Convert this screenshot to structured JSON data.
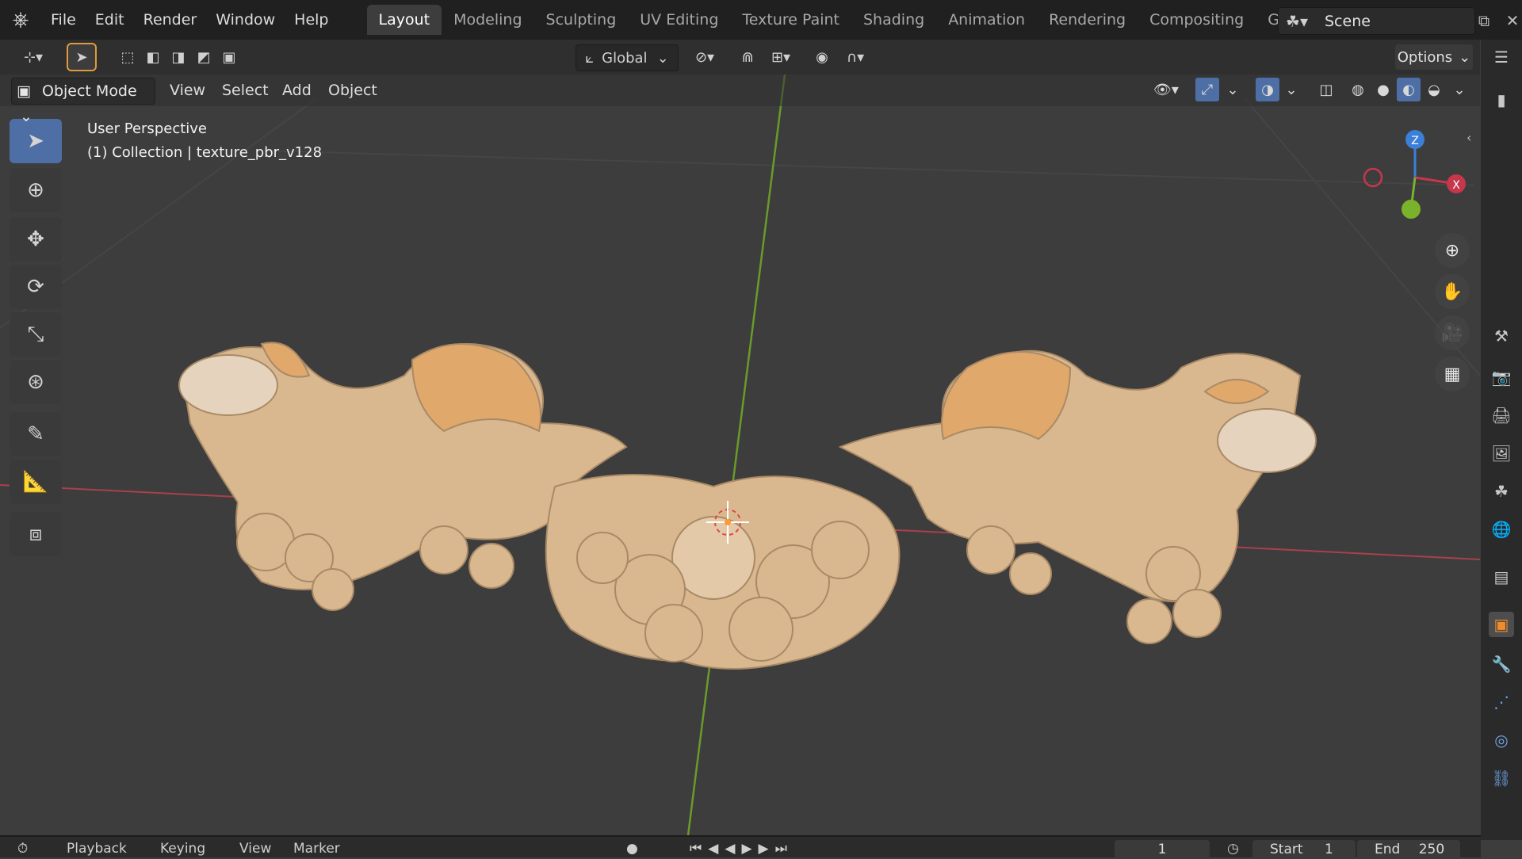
{
  "topbar": {
    "app_icon": "blender-logo-icon",
    "menus": [
      "File",
      "Edit",
      "Render",
      "Window",
      "Help"
    ],
    "workspaces": [
      "Layout",
      "Modeling",
      "Sculpting",
      "UV Editing",
      "Texture Paint",
      "Shading",
      "Animation",
      "Rendering",
      "Compositing",
      "Geometry Nod"
    ],
    "active_workspace": "Layout",
    "scene_label": "Scene"
  },
  "toolheader": {
    "transform_orientation": "Global",
    "options_label": "Options"
  },
  "viewport_header": {
    "mode": "Object Mode",
    "menus": [
      "View",
      "Select",
      "Add",
      "Object"
    ]
  },
  "viewport": {
    "perspective_label": "User Perspective",
    "collection_label": "(1) Collection | texture_pbr_v128",
    "gizmo": {
      "z": "Z",
      "x": "X"
    }
  },
  "timeline": {
    "menus": [
      "Playback",
      "Keying",
      "View",
      "Marker"
    ],
    "current_frame": "1",
    "start_label": "Start",
    "start_value": "1",
    "end_label": "End",
    "end_value": "250"
  },
  "colors": {
    "accent": "#4d6fa5",
    "x_axis": "#c5374b",
    "y_axis": "#7ab22c",
    "z_axis": "#3b7fd8",
    "model": "#d9b78f"
  }
}
